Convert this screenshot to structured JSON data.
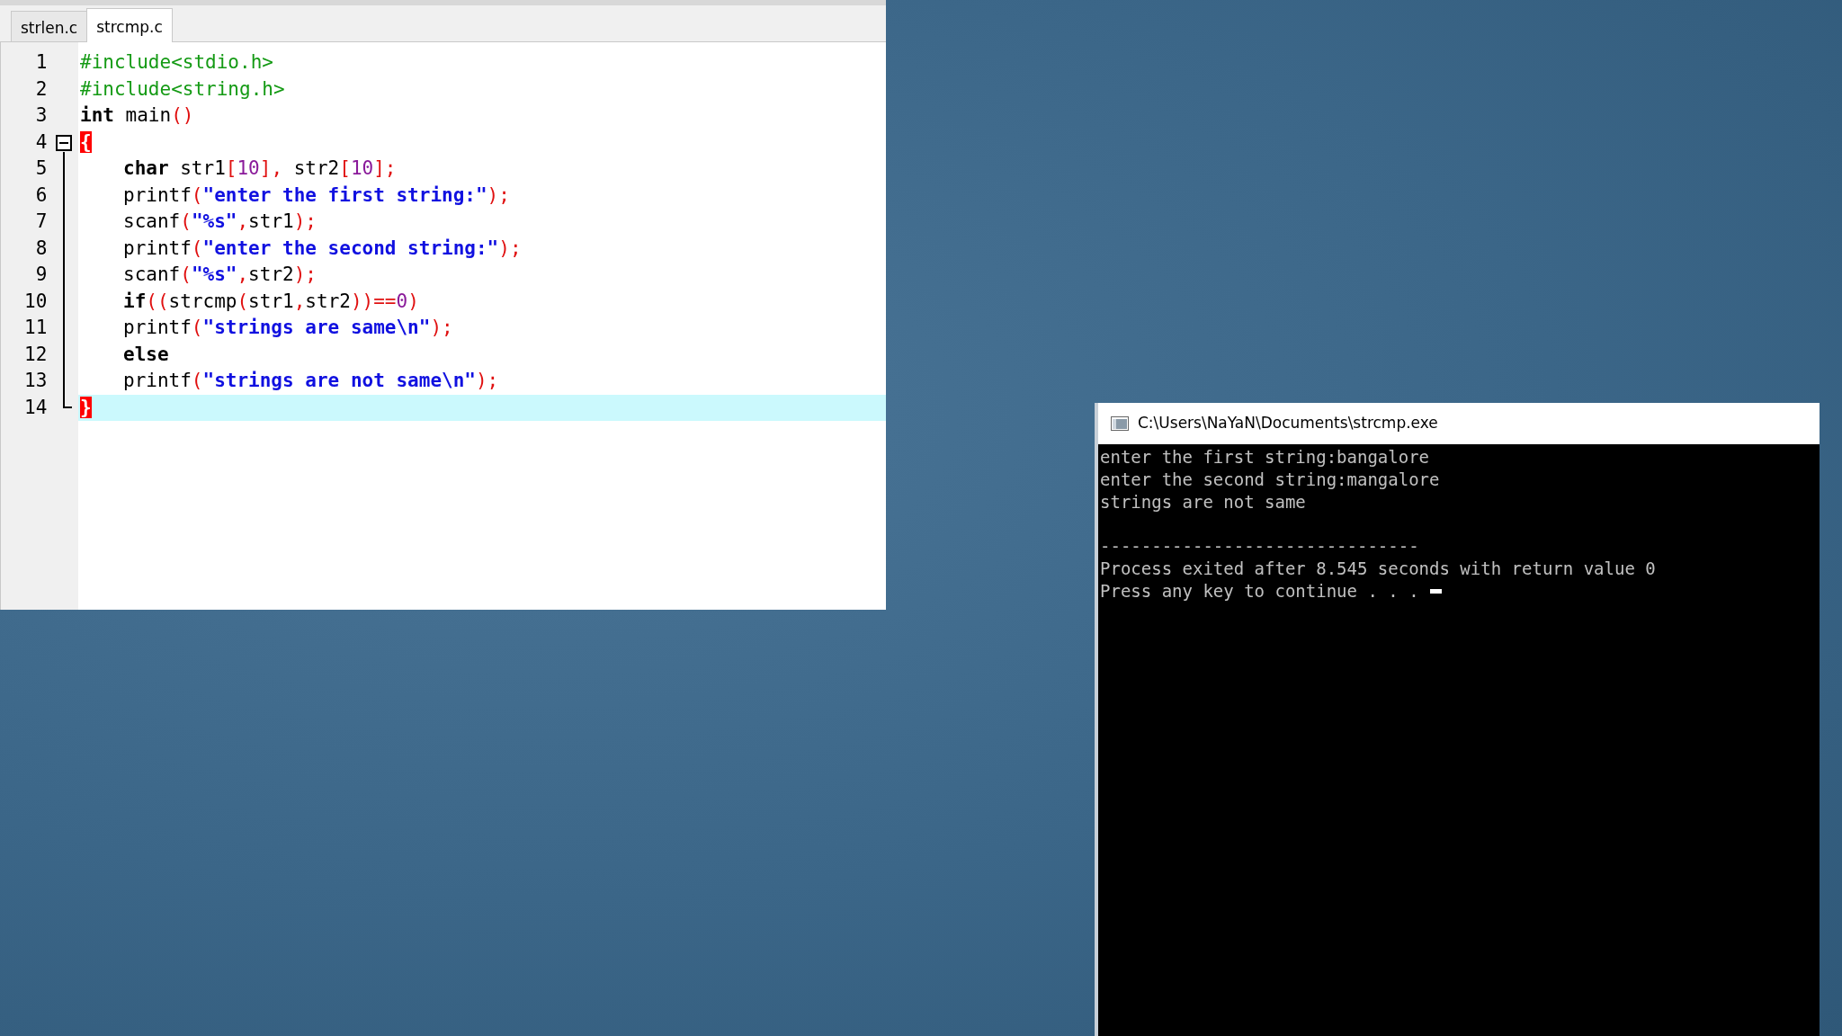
{
  "editor": {
    "tabs": [
      {
        "label": "strlen.c",
        "selected": false
      },
      {
        "label": "strcmp.c",
        "selected": true
      }
    ],
    "lines": [
      {
        "number": "1",
        "current": false,
        "fold": false,
        "indented": false,
        "tokens": [
          {
            "kind": "pre",
            "text": "#include<stdio.h>"
          }
        ]
      },
      {
        "number": "2",
        "current": false,
        "fold": false,
        "indented": false,
        "tokens": [
          {
            "kind": "pre",
            "text": "#include<string.h>"
          }
        ]
      },
      {
        "number": "3",
        "current": false,
        "fold": false,
        "indented": false,
        "tokens": [
          {
            "kind": "kw",
            "text": "int"
          },
          {
            "kind": "plain",
            "text": " main"
          },
          {
            "kind": "sym",
            "text": "()"
          }
        ]
      },
      {
        "number": "4",
        "current": false,
        "fold": true,
        "indented": false,
        "tokens": [
          {
            "kind": "match",
            "text": "{"
          }
        ]
      },
      {
        "number": "5",
        "current": false,
        "fold": false,
        "indented": true,
        "tokens": [
          {
            "kind": "kw",
            "text": "char"
          },
          {
            "kind": "plain",
            "text": " str1"
          },
          {
            "kind": "sym",
            "text": "["
          },
          {
            "kind": "num",
            "text": "10"
          },
          {
            "kind": "sym",
            "text": "],"
          },
          {
            "kind": "plain",
            "text": " str2"
          },
          {
            "kind": "sym",
            "text": "["
          },
          {
            "kind": "num",
            "text": "10"
          },
          {
            "kind": "sym",
            "text": "];"
          }
        ]
      },
      {
        "number": "6",
        "current": false,
        "fold": false,
        "indented": true,
        "tokens": [
          {
            "kind": "plain",
            "text": "printf"
          },
          {
            "kind": "sym",
            "text": "("
          },
          {
            "kind": "str",
            "text": "\"enter the first string:\""
          },
          {
            "kind": "sym",
            "text": ");"
          }
        ]
      },
      {
        "number": "7",
        "current": false,
        "fold": false,
        "indented": true,
        "tokens": [
          {
            "kind": "plain",
            "text": "scanf"
          },
          {
            "kind": "sym",
            "text": "("
          },
          {
            "kind": "str",
            "text": "\"%s\""
          },
          {
            "kind": "sym",
            "text": ","
          },
          {
            "kind": "plain",
            "text": "str1"
          },
          {
            "kind": "sym",
            "text": ");"
          }
        ]
      },
      {
        "number": "8",
        "current": false,
        "fold": false,
        "indented": true,
        "tokens": [
          {
            "kind": "plain",
            "text": "printf"
          },
          {
            "kind": "sym",
            "text": "("
          },
          {
            "kind": "str",
            "text": "\"enter the second string:\""
          },
          {
            "kind": "sym",
            "text": ");"
          }
        ]
      },
      {
        "number": "9",
        "current": false,
        "fold": false,
        "indented": true,
        "tokens": [
          {
            "kind": "plain",
            "text": "scanf"
          },
          {
            "kind": "sym",
            "text": "("
          },
          {
            "kind": "str",
            "text": "\"%s\""
          },
          {
            "kind": "sym",
            "text": ","
          },
          {
            "kind": "plain",
            "text": "str2"
          },
          {
            "kind": "sym",
            "text": ");"
          }
        ]
      },
      {
        "number": "10",
        "current": false,
        "fold": false,
        "indented": true,
        "tokens": [
          {
            "kind": "kw",
            "text": "if"
          },
          {
            "kind": "sym",
            "text": "(("
          },
          {
            "kind": "plain",
            "text": "strcmp"
          },
          {
            "kind": "sym",
            "text": "("
          },
          {
            "kind": "plain",
            "text": "str1"
          },
          {
            "kind": "sym",
            "text": ","
          },
          {
            "kind": "plain",
            "text": "str2"
          },
          {
            "kind": "sym",
            "text": "))=="
          },
          {
            "kind": "num",
            "text": "0"
          },
          {
            "kind": "sym",
            "text": ")"
          }
        ]
      },
      {
        "number": "11",
        "current": false,
        "fold": false,
        "indented": true,
        "tokens": [
          {
            "kind": "plain",
            "text": "printf"
          },
          {
            "kind": "sym",
            "text": "("
          },
          {
            "kind": "str",
            "text": "\"strings are same\\n\""
          },
          {
            "kind": "sym",
            "text": ");"
          }
        ]
      },
      {
        "number": "12",
        "current": false,
        "fold": false,
        "indented": true,
        "tokens": [
          {
            "kind": "kw",
            "text": "else"
          }
        ]
      },
      {
        "number": "13",
        "current": false,
        "fold": false,
        "indented": true,
        "tokens": [
          {
            "kind": "plain",
            "text": "printf"
          },
          {
            "kind": "sym",
            "text": "("
          },
          {
            "kind": "str",
            "text": "\"strings are not same\\n\""
          },
          {
            "kind": "sym",
            "text": ");"
          }
        ]
      },
      {
        "number": "14",
        "current": true,
        "fold": false,
        "indented": false,
        "tokens": [
          {
            "kind": "match",
            "text": "}"
          }
        ]
      }
    ]
  },
  "console": {
    "title": "C:\\Users\\NaYaN\\Documents\\strcmp.exe",
    "output": [
      "enter the first string:bangalore",
      "enter the second string:mangalore",
      "strings are not same"
    ],
    "footer": [
      "-------------------------------",
      "Process exited after 8.545 seconds with return value 0",
      "Press any key to continue . . ."
    ]
  }
}
